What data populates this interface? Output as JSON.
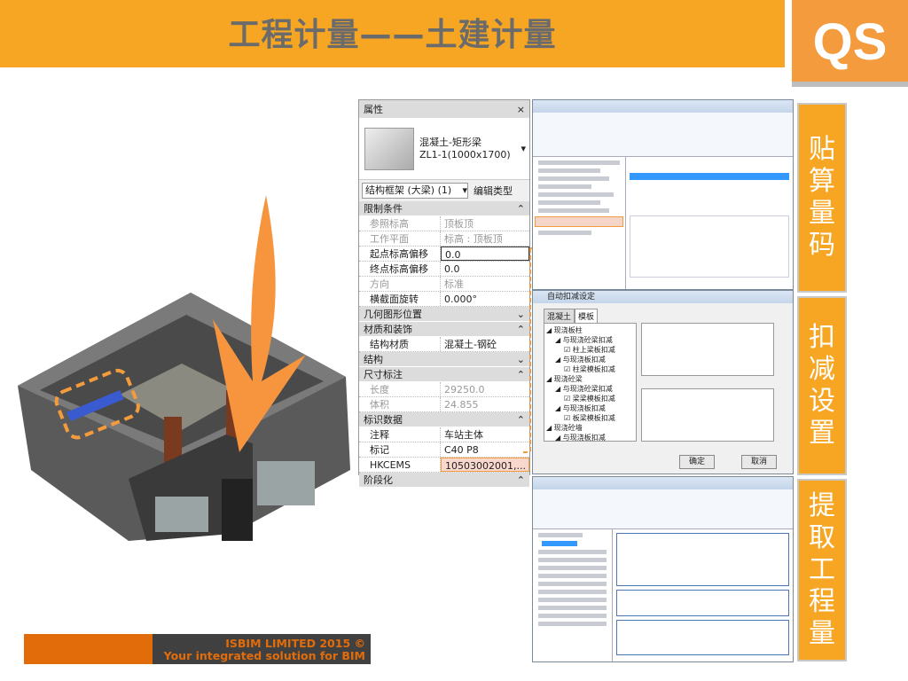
{
  "slide": {
    "title": "工程计量——土建计量",
    "logo": "QS",
    "steps": [
      "贴算量码",
      "扣减设置",
      "提取工程量"
    ],
    "footer": {
      "line1": "ISBIM LIMITED 2015 ©",
      "line2": "Your integrated solution for BIM"
    }
  },
  "colors": {
    "accent": "#f6a623",
    "footer_orange": "#e36c0a",
    "footer_dark": "#404040"
  },
  "properties": {
    "header": "属性",
    "close": "×",
    "family": "混凝土-矩形梁",
    "type": "ZL1-1(1000x1700)",
    "selector": "结构框架 (大梁) (1)",
    "edit_type": "编辑类型",
    "sections": [
      {
        "name": "限制条件",
        "toggle": "⌃",
        "rows": [
          {
            "k": "参照标高",
            "v": "顶板顶",
            "grey": true
          },
          {
            "k": "工作平面",
            "v": "标高 : 顶板顶",
            "grey": true
          },
          {
            "k": "起点标高偏移",
            "v": "0.0",
            "edit": true
          },
          {
            "k": "终点标高偏移",
            "v": "0.0"
          },
          {
            "k": "方向",
            "v": "标准",
            "grey": true
          },
          {
            "k": "横截面旋转",
            "v": "0.000°"
          }
        ]
      },
      {
        "name": "几何图形位置",
        "toggle": "⌄",
        "rows": []
      },
      {
        "name": "材质和装饰",
        "toggle": "⌃",
        "rows": [
          {
            "k": "结构材质",
            "v": "混凝土-钢砼"
          }
        ]
      },
      {
        "name": "结构",
        "toggle": "⌄",
        "rows": []
      },
      {
        "name": "尺寸标注",
        "toggle": "⌃",
        "rows": [
          {
            "k": "长度",
            "v": "29250.0",
            "grey": true
          },
          {
            "k": "体积",
            "v": "24.855",
            "grey": true
          }
        ]
      },
      {
        "name": "标识数据",
        "toggle": "⌃",
        "rows": [
          {
            "k": "注释",
            "v": "车站主体"
          },
          {
            "k": "标记",
            "v": "C40 P8"
          },
          {
            "k": "HKCEMS",
            "v": "10503002001,...",
            "hl": true
          }
        ]
      },
      {
        "name": "阶段化",
        "toggle": "⌃",
        "rows": []
      }
    ]
  },
  "dialog2": {
    "title": "自动扣减设定",
    "tabs": [
      "混凝土",
      "模板"
    ],
    "tree": [
      "现浇板柱",
      "与现浇砼梁扣减",
      "柱上梁板扣减",
      "与现浇板扣减",
      "柱梁模板扣减",
      "现浇砼梁",
      "与现浇砼梁扣减",
      "梁梁模板扣减",
      "与现浇板扣减",
      "板梁模板扣减",
      "现浇砼墙",
      "与现浇板扣减"
    ],
    "ok": "确定",
    "cancel": "取消"
  }
}
